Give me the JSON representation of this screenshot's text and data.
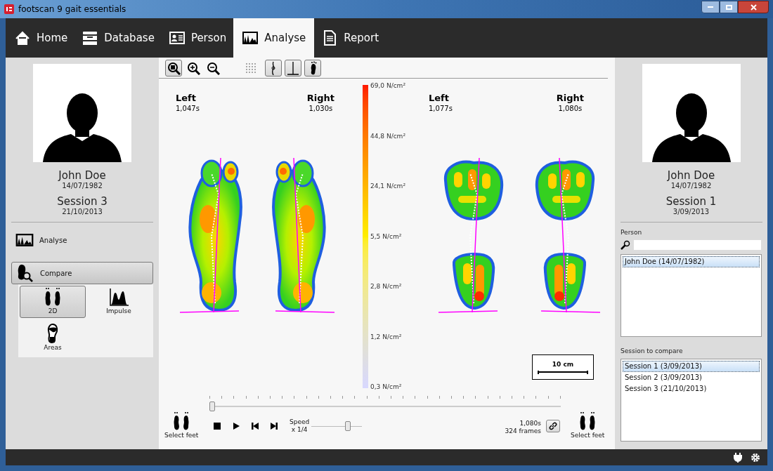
{
  "window": {
    "title": "footscan 9 gait essentials"
  },
  "tabs": [
    {
      "label": "Home",
      "selected": false
    },
    {
      "label": "Database",
      "selected": false
    },
    {
      "label": "Person",
      "selected": false
    },
    {
      "label": "Analyse",
      "selected": true
    },
    {
      "label": "Report",
      "selected": false
    }
  ],
  "left_panel": {
    "name": "John Doe",
    "birthdate": "14/07/1982",
    "session": "Session 3",
    "session_date": "21/10/2013",
    "menu": [
      {
        "label": "Analyse",
        "selected": false
      },
      {
        "label": "Compare",
        "selected": true
      }
    ],
    "compare_views": [
      {
        "label": "2D",
        "selected": true
      },
      {
        "label": "Impulse",
        "selected": false
      },
      {
        "label": "Areas",
        "selected": false
      }
    ]
  },
  "toolbar": [
    {
      "selected": true
    },
    {
      "selected": false
    },
    {
      "selected": false
    },
    {
      "selected": false
    },
    {
      "selected": true
    },
    {
      "selected": true
    },
    {
      "selected": true
    }
  ],
  "pressure_scale": [
    "69,0 N/cm²",
    "44,8 N/cm²",
    "24,1 N/cm²",
    "5,5 N/cm²",
    "2,8 N/cm²",
    "1,2 N/cm²",
    "0,3 N/cm²"
  ],
  "recordings": [
    {
      "feet": [
        {
          "side": "Left",
          "time": "1,047s"
        },
        {
          "side": "Right",
          "time": "1,030s"
        }
      ]
    },
    {
      "feet": [
        {
          "side": "Left",
          "time": "1,077s"
        },
        {
          "side": "Right",
          "time": "1,080s"
        }
      ]
    }
  ],
  "scale_legend": "10 cm",
  "playback": {
    "timeline": {
      "level": 0
    },
    "speed_label": "Speed",
    "speed_value": "x 1/4",
    "speed_slider": {
      "level": 0.75
    },
    "duration": "1,080s",
    "frames": "324 frames",
    "select_feet": [
      "Select feet",
      "Select feet"
    ]
  },
  "right_panel": {
    "name": "John Doe",
    "birthdate": "14/07/1982",
    "session": "Session 1",
    "session_date": "3/09/2013",
    "person_label": "Person",
    "persons": [
      {
        "label": "John Doe (14/07/1982)",
        "selected": true
      }
    ],
    "session_label": "Session to compare",
    "sessions": [
      {
        "label": "Session 1 (3/09/2013)",
        "selected": true
      },
      {
        "label": "Session 2 (3/09/2013)",
        "selected": false
      },
      {
        "label": "Session 3 (21/10/2013)",
        "selected": false
      }
    ]
  }
}
